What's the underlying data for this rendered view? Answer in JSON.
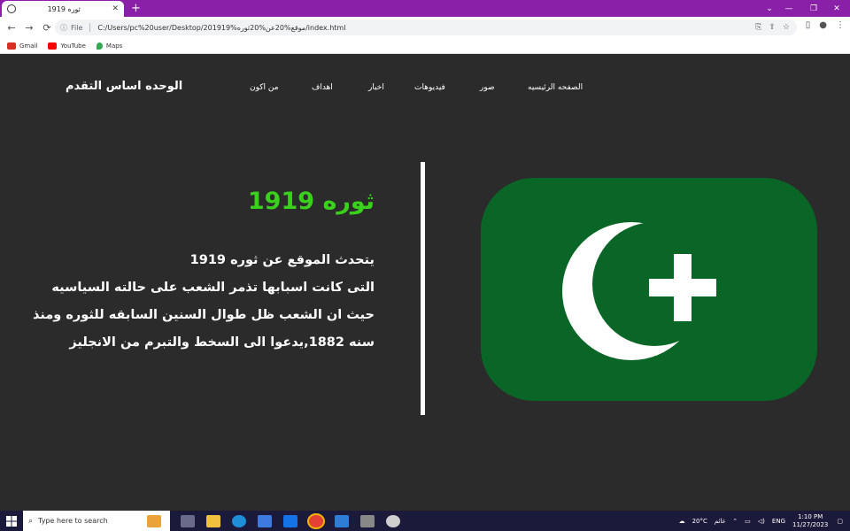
{
  "browser": {
    "tab_title": "ثوره 1919",
    "tab_close": "✕",
    "new_tab": "+",
    "window_controls": {
      "minimize": "—",
      "restore": "❐",
      "close": "✕",
      "tabsearch": "⌄"
    },
    "back": "←",
    "forward": "→",
    "reload": "⟳",
    "url_scheme_label": "File",
    "url": "C:/Users/pc%20user/Desktop/201919%موقع%20عن%20ثوره/index.html",
    "bookmarks": [
      {
        "label": "Gmail",
        "color": "#d93025"
      },
      {
        "label": "YouTube",
        "color": "#ff0000"
      },
      {
        "label": "Maps",
        "color": "#34a853"
      }
    ]
  },
  "site": {
    "brand": "الوحده اساس التقدم",
    "nav": [
      "الصفحه الرئيسيه",
      "صور",
      "فيديوهات",
      "اخبار",
      "اهداف",
      "من اكون"
    ],
    "heading": "ثوره 1919",
    "paragraph_lines": [
      "يتحدث الموقع عن ثوره 1919",
      "التى كانت اسبابها تذمر الشعب على حالته السياسيه",
      "حيث ان الشعب ظل طوال السنين السابقه للثوره ومنذ",
      "سنه 1882,يدعوا الى السخط والتبرم من الانجليز"
    ],
    "colors": {
      "background": "#2b2b2b",
      "heading": "#39d11c",
      "flag_green": "#0a6626"
    }
  },
  "taskbar": {
    "search_placeholder": "Type here to search",
    "weather": "20°C",
    "weather_label": "غائم",
    "language": "ENG",
    "time": "1:10 PM",
    "date": "11/27/2023"
  }
}
